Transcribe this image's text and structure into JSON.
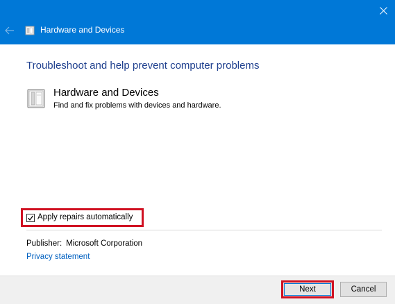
{
  "window": {
    "title": "Hardware and Devices",
    "icons": {
      "close": "close-icon",
      "back": "back-arrow-icon",
      "title": "hardware-devices-icon"
    }
  },
  "content": {
    "heading": "Troubleshoot and help prevent computer problems",
    "item": {
      "title": "Hardware and Devices",
      "description": "Find and fix problems with devices and hardware.",
      "icon": "hardware-devices-icon"
    },
    "apply_repairs": {
      "label": "Apply repairs automatically",
      "checked": true
    },
    "publisher": {
      "label": "Publisher:",
      "value": "Microsoft Corporation"
    },
    "privacy_link": "Privacy statement"
  },
  "footer": {
    "next_label": "Next",
    "cancel_label": "Cancel"
  },
  "colors": {
    "titlebar": "#0078d7",
    "heading": "#1e3f8e",
    "link": "#0060c0",
    "highlight": "#d01122",
    "footer_bg": "#f0f0f0"
  }
}
